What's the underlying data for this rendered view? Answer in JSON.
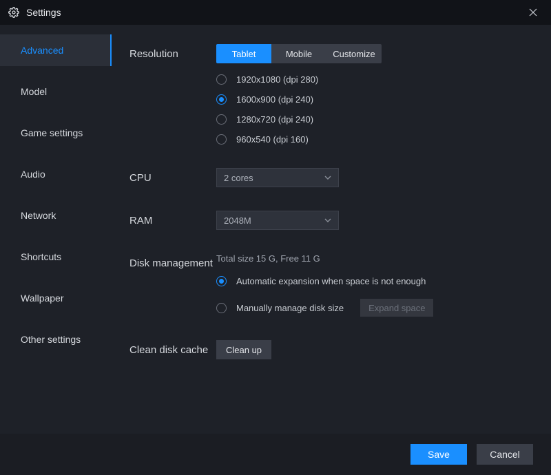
{
  "window": {
    "title": "Settings"
  },
  "sidebar": {
    "items": [
      {
        "label": "Advanced",
        "active": true
      },
      {
        "label": "Model"
      },
      {
        "label": "Game settings"
      },
      {
        "label": "Audio"
      },
      {
        "label": "Network"
      },
      {
        "label": "Shortcuts"
      },
      {
        "label": "Wallpaper"
      },
      {
        "label": "Other settings"
      }
    ]
  },
  "resolution": {
    "label": "Resolution",
    "tabs": {
      "tablet": "Tablet",
      "mobile": "Mobile",
      "customize": "Customize"
    },
    "active_tab": "tablet",
    "options": [
      {
        "label": "1920x1080  (dpi 280)"
      },
      {
        "label": "1600x900  (dpi 240)",
        "checked": true
      },
      {
        "label": "1280x720  (dpi 240)"
      },
      {
        "label": "960x540  (dpi 160)"
      }
    ]
  },
  "cpu": {
    "label": "CPU",
    "value": "2 cores"
  },
  "ram": {
    "label": "RAM",
    "value": "2048M"
  },
  "disk": {
    "label": "Disk management",
    "status": "Total size 15 G,  Free 11 G",
    "auto_label": "Automatic expansion when space is not enough",
    "manual_label": "Manually manage disk size",
    "expand_btn": "Expand space",
    "mode": "auto"
  },
  "cache": {
    "label": "Clean disk cache",
    "button": "Clean up"
  },
  "footer": {
    "save": "Save",
    "cancel": "Cancel"
  }
}
